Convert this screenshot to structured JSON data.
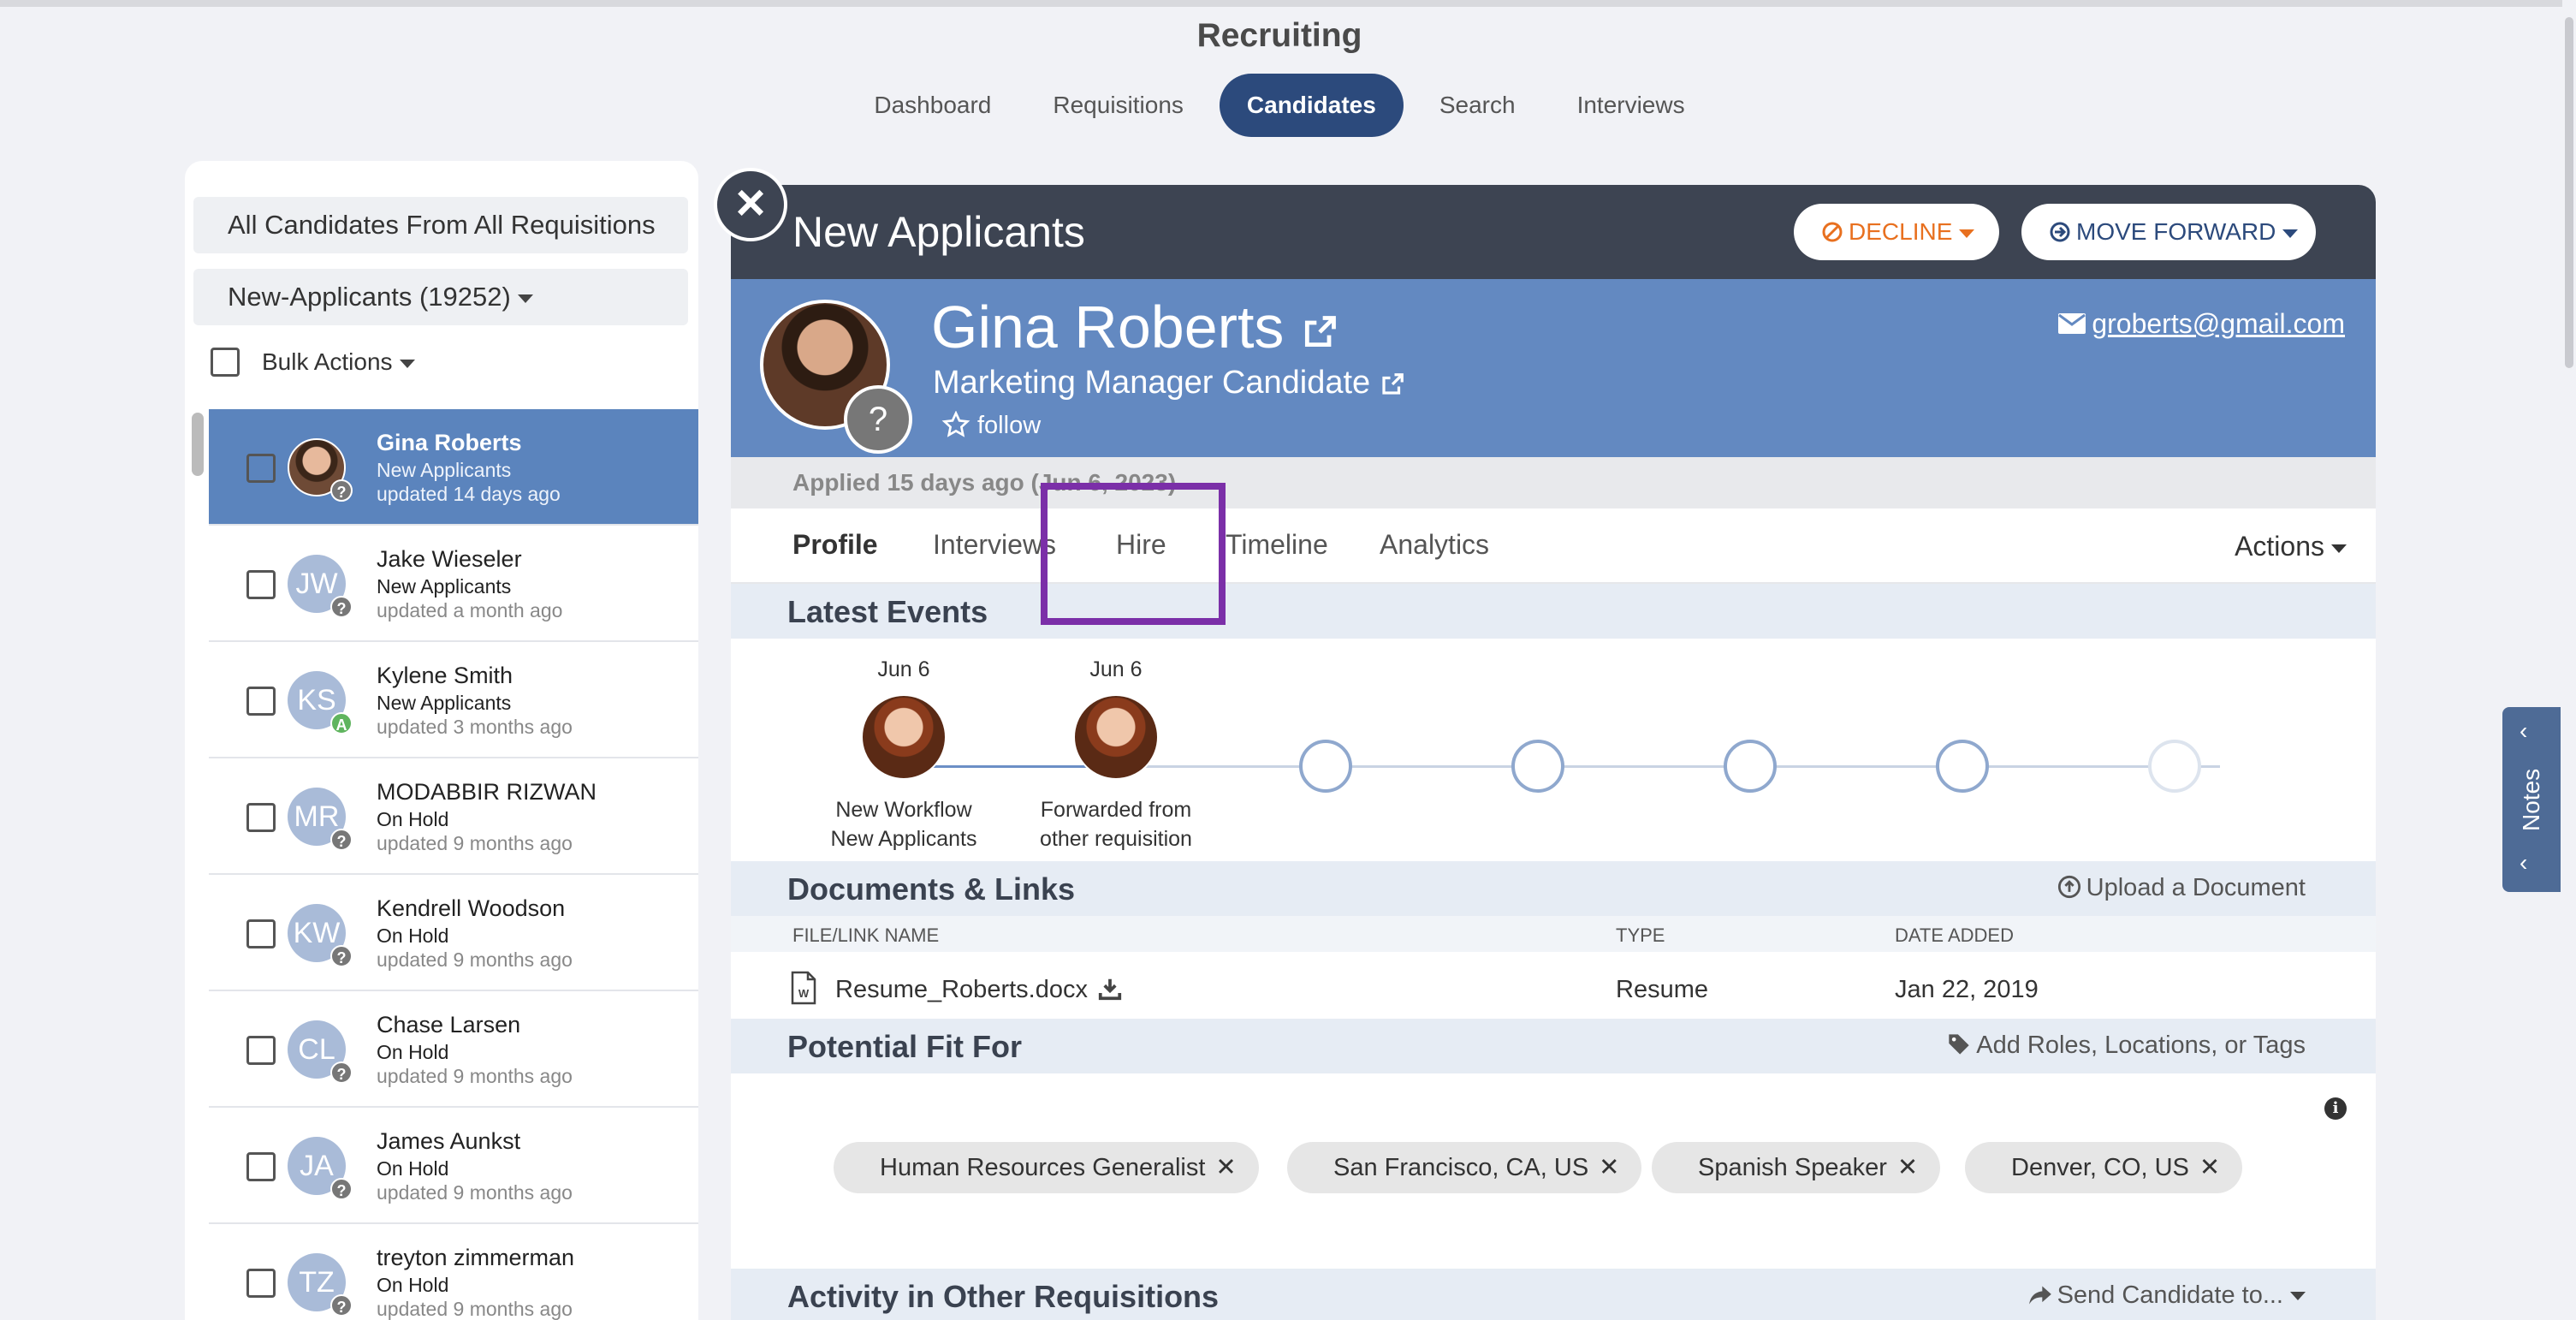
{
  "app": {
    "title": "Recruiting",
    "nav": [
      "Dashboard",
      "Requisitions",
      "Candidates",
      "Search",
      "Interviews"
    ],
    "active_nav": "Candidates"
  },
  "left_panel": {
    "requisition_filter": "All Candidates From All Requisitions",
    "stage_filter": "New-Applicants (19252)",
    "bulk_actions": "Bulk Actions",
    "candidates": [
      {
        "initials": "",
        "name": "Gina Roberts",
        "status": "New Applicants",
        "updated": "updated 14 days ago",
        "badge": "?",
        "selected": true
      },
      {
        "initials": "JW",
        "name": "Jake Wieseler",
        "status": "New Applicants",
        "updated": "updated a month ago",
        "badge": "?"
      },
      {
        "initials": "KS",
        "name": "Kylene Smith",
        "status": "New Applicants",
        "updated": "updated 3 months ago",
        "badge": "A"
      },
      {
        "initials": "MR",
        "name": "MODABBIR RIZWAN",
        "status": "On Hold",
        "updated": "updated 9 months ago",
        "badge": "?"
      },
      {
        "initials": "KW",
        "name": "Kendrell Woodson",
        "status": "On Hold",
        "updated": "updated 9 months ago",
        "badge": "?"
      },
      {
        "initials": "CL",
        "name": "Chase Larsen",
        "status": "On Hold",
        "updated": "updated 9 months ago",
        "badge": "?"
      },
      {
        "initials": "JA",
        "name": "James Aunkst",
        "status": "On Hold",
        "updated": "updated 9 months ago",
        "badge": "?"
      },
      {
        "initials": "TZ",
        "name": "treyton zimmerman",
        "status": "On Hold",
        "updated": "updated 9 months ago",
        "badge": "?"
      }
    ]
  },
  "main": {
    "header_title": "New Applicants",
    "decline_label": "DECLINE",
    "move_forward_label": "MOVE FORWARD",
    "candidate": {
      "name": "Gina Roberts",
      "role": "Marketing Manager Candidate",
      "follow": "follow",
      "email": "groberts@gmail.com",
      "status_badge": "?"
    },
    "applied": "Applied 15 days ago (Jun 6, 2023)",
    "tabs": [
      "Profile",
      "Interviews",
      "Hire",
      "Timeline",
      "Analytics"
    ],
    "active_tab": "Profile",
    "actions_label": "Actions",
    "latest_events": {
      "title": "Latest Events",
      "events": [
        {
          "date": "Jun 6",
          "line1": "New Workflow",
          "line2": "New Applicants"
        },
        {
          "date": "Jun 6",
          "line1": "Forwarded from",
          "line2": "other requisition"
        }
      ]
    },
    "documents": {
      "title": "Documents & Links",
      "upload_label": "Upload a Document",
      "columns": [
        "FILE/LINK NAME",
        "TYPE",
        "DATE ADDED"
      ],
      "rows": [
        {
          "name": "Resume_Roberts.docx",
          "type": "Resume",
          "date": "Jan 22, 2019"
        }
      ]
    },
    "potential_fit": {
      "title": "Potential Fit For",
      "add_label": "Add Roles, Locations, or Tags",
      "tags": [
        "Human Resources Generalist",
        "San Francisco, CA, US",
        "Spanish Speaker",
        "Denver, CO, US"
      ]
    },
    "activity": {
      "title": "Activity in Other Requisitions",
      "send_label": "Send Candidate to..."
    }
  },
  "notes_tab": "Notes",
  "colors": {
    "nav_active": "#2c4a7c",
    "profile_band": "#6389c1",
    "header_dark": "#3d4452",
    "decline": "#e8701f",
    "highlight": "#7b2fa8"
  }
}
